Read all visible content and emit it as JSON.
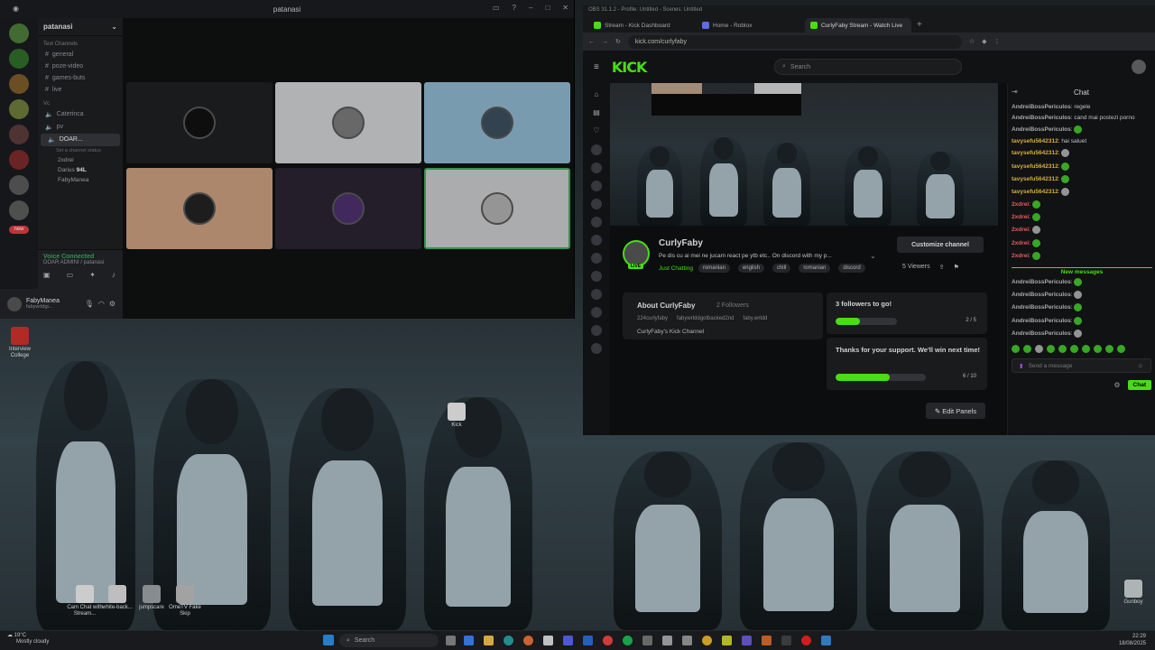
{
  "discord": {
    "window_title": "patanasi",
    "server_name": "patanasi",
    "cat_text": "Text Channels",
    "text_channels": [
      "general",
      "poze-video",
      "games-buts",
      "live"
    ],
    "cat_voice": "Vc",
    "voice_channels": [
      "Caterinca",
      "pv",
      "DOAR..."
    ],
    "channel_status": "Set a channel status",
    "voice_users": [
      "2xdrei",
      "Darius",
      "FabyManea"
    ],
    "voice_user_badge": "94L",
    "rail_badge": "new",
    "voice_connected": "Voice Connected",
    "voice_location": "DOAR ADMINI / patanasi",
    "user_name": "FabyManea",
    "user_status": "fabywrldgi..."
  },
  "desktop": {
    "icons": [
      "Interview College",
      "Kick",
      "Cam Chat with Stream...",
      "white-back...",
      "jumpscare",
      "OmeTV Fake Skip",
      "Gunboy"
    ]
  },
  "browser": {
    "window_caption": "OBS 31.1.2 - Profile: Untitled - Scenes: Untitled",
    "tabs": [
      "Stream - Kick Dashboard",
      "Home - Roblox",
      "CurlyFaby Stream - Watch Live"
    ],
    "tab_colors": [
      "#53fc18",
      "#6b7cff",
      "#53fc18"
    ],
    "url": "kick.com/curlyfaby"
  },
  "kick": {
    "logo": "KICK",
    "search_placeholder": "Search",
    "streamer": "CurlyFaby",
    "stream_title": "Pe dis cu ai mei ne jucam react pe ytb etc.. On discord with my p...",
    "live_badge": "LIVE",
    "category": "Just Chatting",
    "tags": [
      "romanian",
      "english",
      "chill",
      "romanian",
      "discord"
    ],
    "customize_button": "Customize channel",
    "viewers": "5 Viewers",
    "about_title": "About CurlyFaby",
    "followers": "2 Followers",
    "socials": [
      "224curlyfaby",
      "fabywrlddgotbacked2nd",
      "faby.wrldd"
    ],
    "channel_desc": "CurlyFaby's Kick Channel",
    "goal1_title": "3 followers to go!",
    "goal1_count": "2 / 5",
    "goal1_progress": 0.4,
    "goal2_title": "Thanks for your support. We'll win next time!",
    "goal2_count": "6 / 10",
    "goal2_progress": 0.6,
    "edit_panels": "Edit Panels",
    "accent": "#53fc18"
  },
  "chat": {
    "title": "Chat",
    "messages": [
      {
        "user": "AndreiBossPericulos",
        "text": "regele"
      },
      {
        "user": "AndreiBossPericulos",
        "text": "cand mai postezi porno"
      },
      {
        "user": "AndreiBossPericulos",
        "text": ""
      },
      {
        "user": "tavysefu5642312",
        "text": "hai saluet"
      },
      {
        "user": "tavysefu5642312",
        "text": ""
      },
      {
        "user": "tavysefu5642312",
        "text": ""
      },
      {
        "user": "tavysefu5642312",
        "text": ""
      },
      {
        "user": "tavysefu5642312",
        "text": ""
      },
      {
        "user": "2xdrei",
        "text": ""
      },
      {
        "user": "2xdrei",
        "text": ""
      },
      {
        "user": "2xdrei",
        "text": ""
      },
      {
        "user": "2xdrei",
        "text": ""
      },
      {
        "user": "2xdrei",
        "text": ""
      }
    ],
    "new_messages_label": "New messages",
    "new_messages": [
      {
        "user": "AndreiBossPericulos",
        "text": ""
      },
      {
        "user": "AndreiBossPericulos",
        "text": ""
      },
      {
        "user": "AndreiBossPericulos",
        "text": ""
      },
      {
        "user": "AndreiBossPericulos",
        "text": ""
      },
      {
        "user": "AndreiBossPericulos",
        "text": ""
      }
    ],
    "input_placeholder": "Send a message",
    "send_button": "Chat"
  },
  "taskbar": {
    "weather_temp": "19°C",
    "weather_desc": "Mostly cloudy",
    "search_placeholder": "Search",
    "time": "22:29",
    "date": "18/08/2025"
  }
}
